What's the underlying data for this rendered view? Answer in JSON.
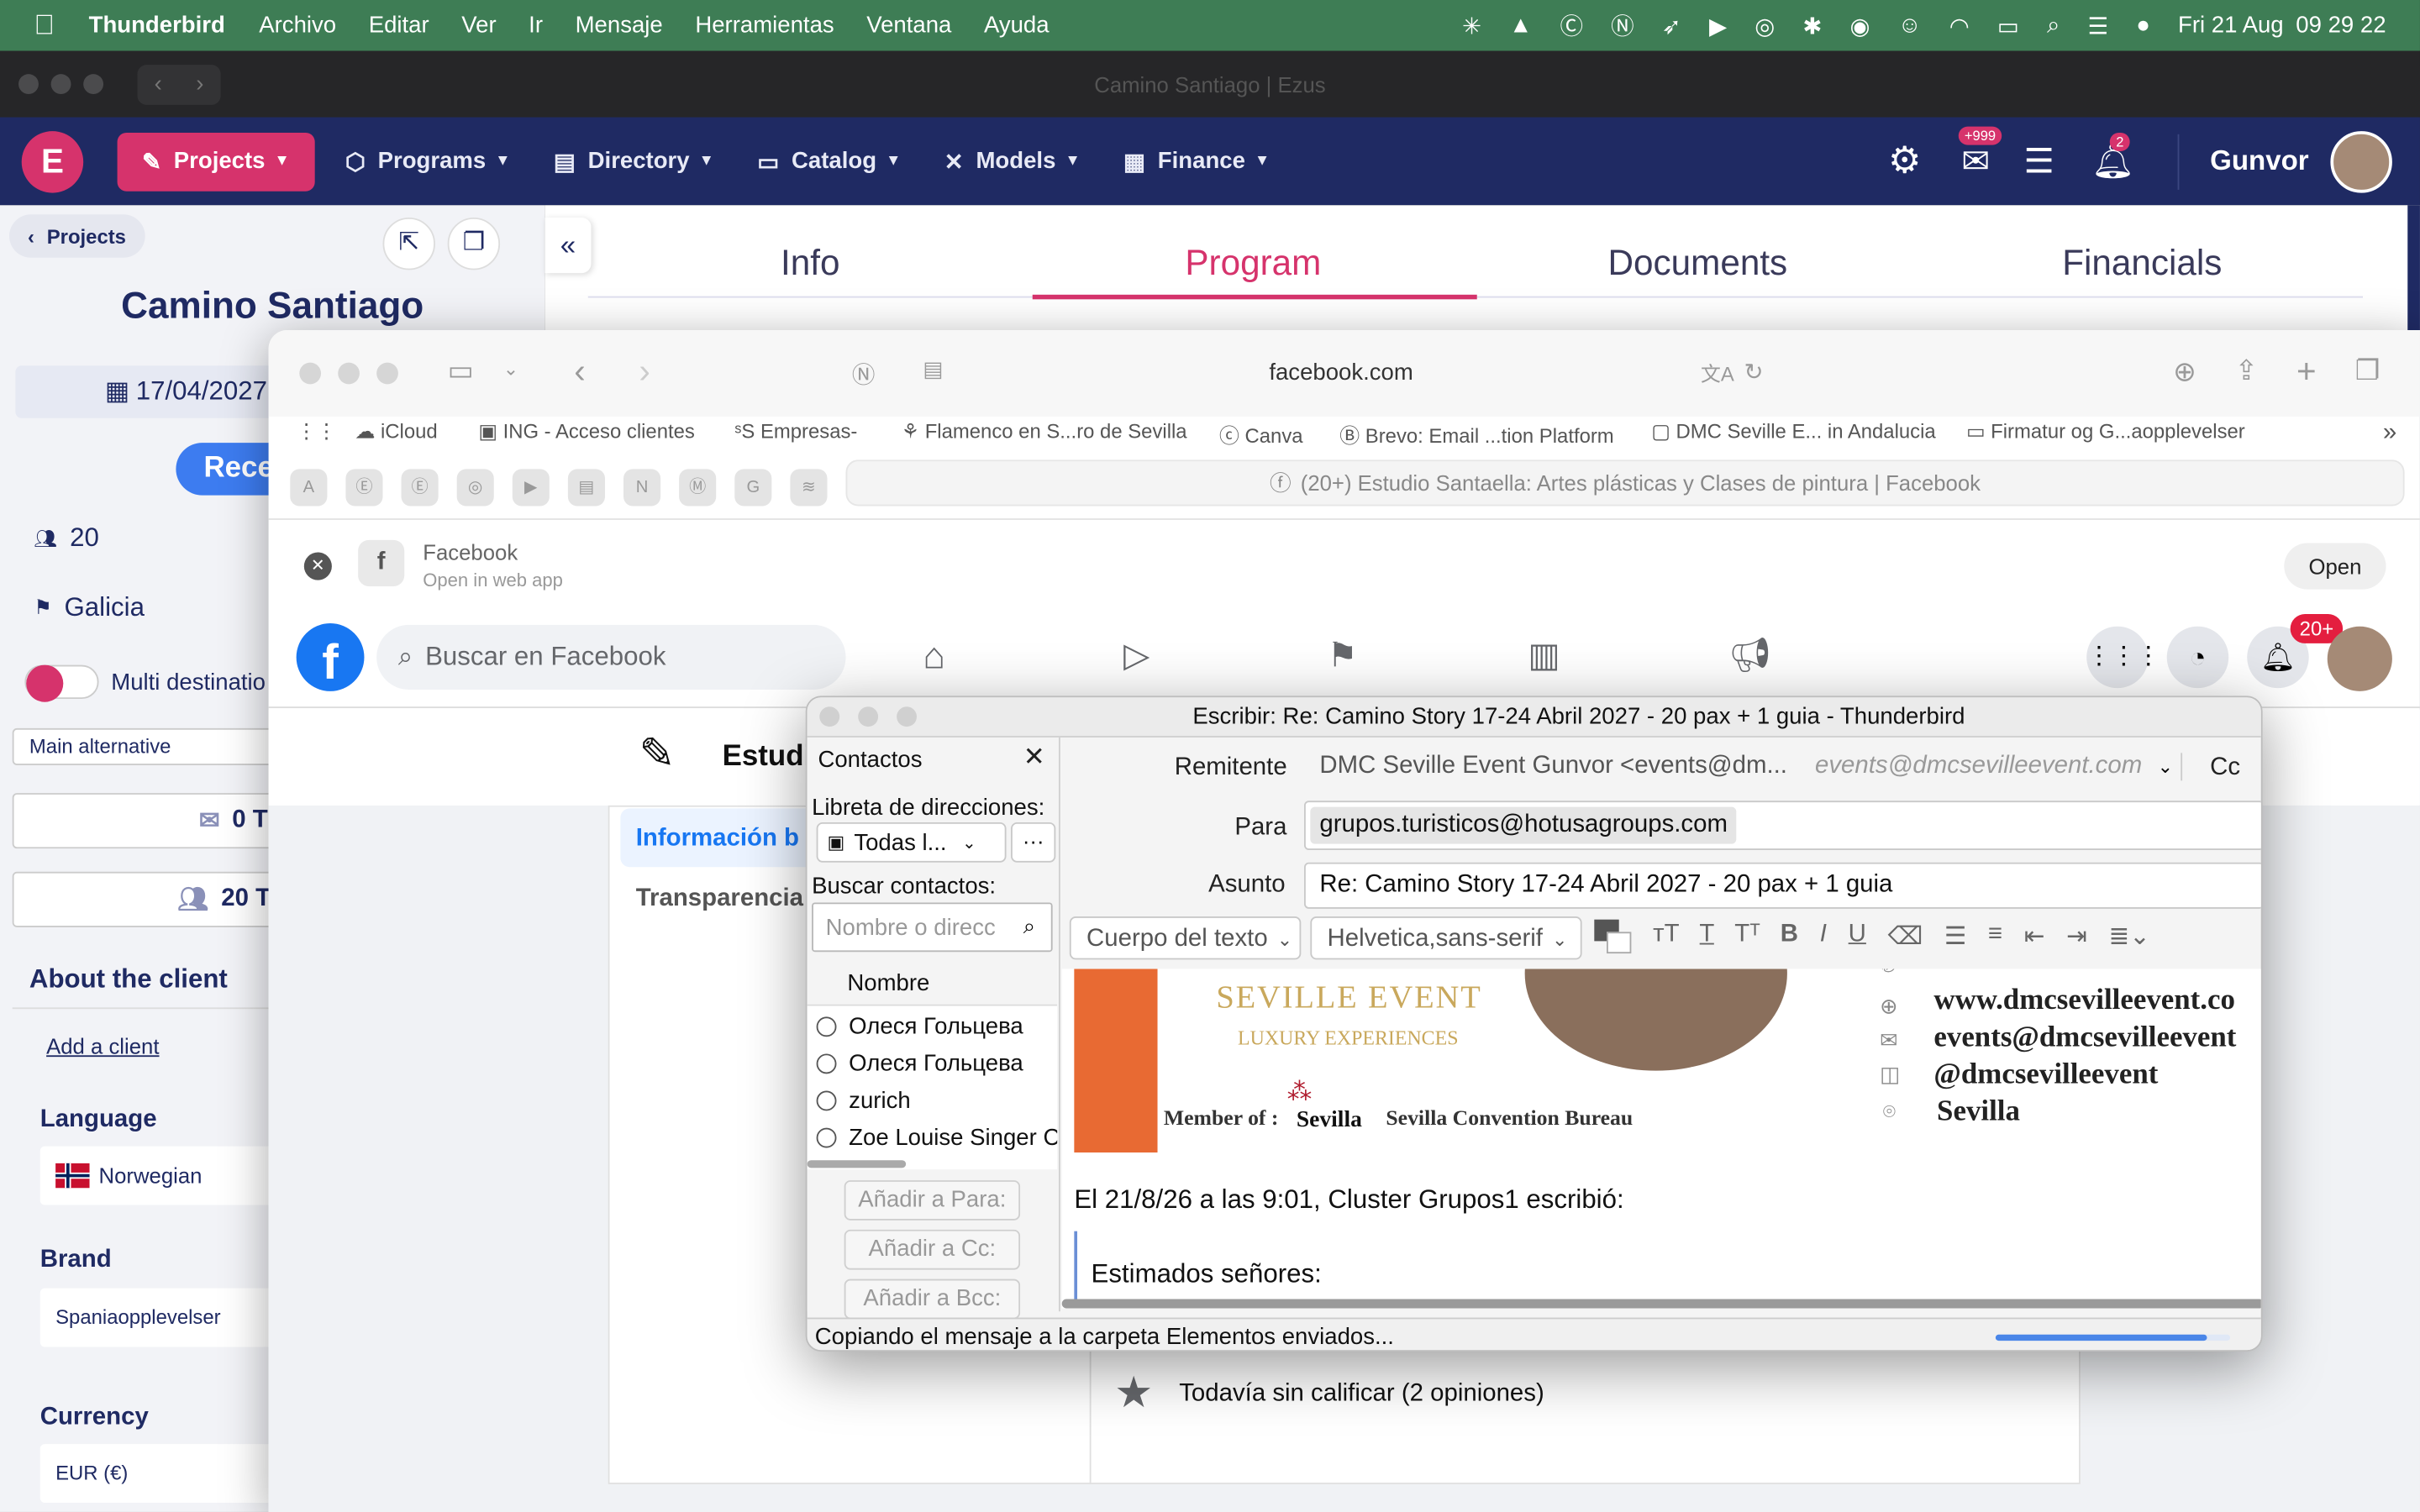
{
  "menubar": {
    "app": "Thunderbird",
    "items": [
      "Archivo",
      "Editar",
      "Ver",
      "Ir",
      "Mensaje",
      "Herramientas",
      "Ventana",
      "Ayuda"
    ],
    "date": "Fri 21 Aug",
    "time": "09 29 22"
  },
  "window": {
    "title": "Camino Santiago | Ezus"
  },
  "appnav": {
    "items": [
      {
        "label": "Projects",
        "icon": "edit-icon"
      },
      {
        "label": "Programs",
        "icon": "cube-icon"
      },
      {
        "label": "Directory",
        "icon": "address-book-icon"
      },
      {
        "label": "Catalog",
        "icon": "monitor-icon"
      },
      {
        "label": "Models",
        "icon": "tools-icon"
      },
      {
        "label": "Finance",
        "icon": "document-icon"
      }
    ],
    "mail_badge": "+999",
    "notif_badge": "2",
    "user": "Gunvor"
  },
  "project": {
    "back": "Projects",
    "title": "Camino Santiago",
    "date": "17/04/2027",
    "button": "Rece",
    "pax": "20",
    "region": "Galicia",
    "multi": "Multi destinatio",
    "alternative": "Main alternative",
    "btn1": "0 T",
    "btn2": "20 Tr",
    "about": "About the client",
    "add_client": "Add a client",
    "language_label": "Language",
    "language": "Norwegian",
    "brand_label": "Brand",
    "brand": "Spaniaopplevelser",
    "currency_label": "Currency",
    "currency": "EUR (€)"
  },
  "tabs": [
    "Info",
    "Program",
    "Documents",
    "Financials"
  ],
  "safari": {
    "url": "facebook.com",
    "bookmarks": [
      "iCloud",
      "ING - Acceso clientes",
      "Empresas-",
      "Flamenco en S...ro de Sevilla",
      "Canva",
      "Brevo: Email ...tion Platform",
      "DMC Seville E... in Andalucia",
      "Firmatur og G...aopplevelser"
    ],
    "tab_title": "(20+) Estudio Santaella: Artes plásticas y Clases de pintura | Facebook",
    "banner_title": "Facebook",
    "banner_sub": "Open in web app",
    "open": "Open",
    "search_placeholder": "Buscar en Facebook",
    "notif_badge": "20+",
    "page_name": "Estudi",
    "info_link": "Información b",
    "transp": "Transparencia",
    "rating": "Todavía sin calificar (2 opiniones)"
  },
  "compose": {
    "title": "Escribir: Re: Camino Story 17-24 Abril 2027 - 20 pax + 1 guia - Thunderbird",
    "contacts_title": "Contactos",
    "addressbook_label": "Libreta de direcciones:",
    "addressbook_value": "Todas l...",
    "search_label": "Buscar contactos:",
    "search_placeholder": "Nombre o direcc",
    "col_name": "Nombre",
    "contacts": [
      "Олеся Гольцева",
      "Олеся Гольцева",
      "zurich",
      "Zoe Louise Singer C"
    ],
    "btn_to": "Añadir a Para:",
    "btn_cc": "Añadir a Cc:",
    "btn_bcc": "Añadir a Bcc:",
    "from_label": "Remitente",
    "from_value": "DMC Seville Event Gunvor <events@dm...",
    "from_email": "events@dmcsevilleevent.com",
    "cc": "Cc",
    "to_label": "Para",
    "to_value": "grupos.turisticos@hotusagroups.com",
    "subject_label": "Asunto",
    "subject_value": "Re: Camino Story 17-24 Abril 2027 - 20 pax + 1 guia",
    "format": "Cuerpo del texto",
    "font": "Helvetica,sans-serif",
    "sig_brand": "SEVILLE EVENT",
    "sig_tag": "LUXURY EXPERIENCES",
    "sig_member": "Member of :",
    "sig_sevilla": "Sevilla",
    "sig_bureau": "Sevilla Convention Bureau",
    "sig_web": "www.dmcsevilleevent.co",
    "sig_email": "events@dmcsevilleevent",
    "sig_ig": "@dmcsevilleevent",
    "sig_city": "Sevilla",
    "quote_header": "El 21/8/26 a las 9:01, Cluster Grupos1 escribió:",
    "quote_greeting": "Estimados señores:",
    "status": "Copiando el mensaje a la carpeta Elementos enviados...",
    "progress": 0.9
  },
  "colors": {
    "menubar": "#3e7d55",
    "nav": "#1f2a63",
    "accent": "#d6336c",
    "facebook": "#1877f2"
  }
}
